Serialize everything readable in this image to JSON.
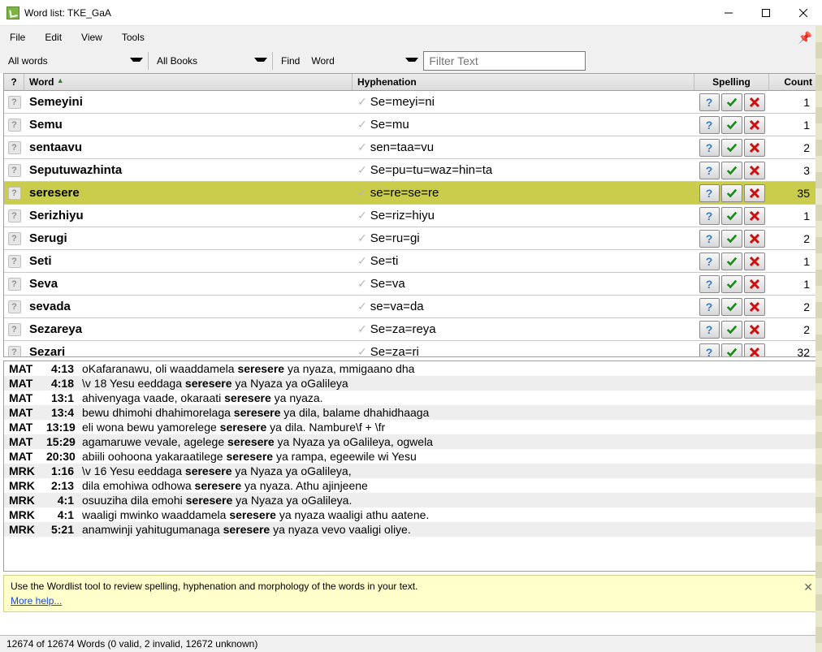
{
  "window": {
    "title": "Word list: TKE_GaA"
  },
  "menu": {
    "file": "File",
    "edit": "Edit",
    "view": "View",
    "tools": "Tools"
  },
  "toolbar": {
    "scope": "All words",
    "books": "All Books",
    "find_label": "Find",
    "find_field": "Word",
    "filter_placeholder": "Filter Text"
  },
  "columns": {
    "q": "?",
    "word": "Word",
    "hyph": "Hyphenation",
    "spell": "Spelling",
    "count": "Count"
  },
  "rows": [
    {
      "word": "Semeyini",
      "hyph": "Se=meyi=ni",
      "count": 1,
      "sel": false
    },
    {
      "word": "Semu",
      "hyph": "Se=mu",
      "count": 1,
      "sel": false
    },
    {
      "word": "sentaavu",
      "hyph": "sen=taa=vu",
      "count": 2,
      "sel": false
    },
    {
      "word": "Seputuwazhinta",
      "hyph": "Se=pu=tu=waz=hin=ta",
      "count": 3,
      "sel": false
    },
    {
      "word": "seresere",
      "hyph": "se=re=se=re",
      "count": 35,
      "sel": true
    },
    {
      "word": "Serizhiyu",
      "hyph": "Se=riz=hiyu",
      "count": 1,
      "sel": false
    },
    {
      "word": "Serugi",
      "hyph": "Se=ru=gi",
      "count": 2,
      "sel": false
    },
    {
      "word": "Seti",
      "hyph": "Se=ti",
      "count": 1,
      "sel": false
    },
    {
      "word": "Seva",
      "hyph": "Se=va",
      "count": 1,
      "sel": false
    },
    {
      "word": "sevada",
      "hyph": "se=va=da",
      "count": 2,
      "sel": false
    },
    {
      "word": "Sezareya",
      "hyph": "Se=za=reya",
      "count": 2,
      "sel": false
    },
    {
      "word": "Sezari",
      "hyph": "Se=za=ri",
      "count": 32,
      "sel": false
    }
  ],
  "concordance": [
    {
      "book": "MAT",
      "cv": "4:13",
      "pre": "oKafaranawu, oli waaddamela ",
      "hit": "seresere",
      "post": " ya nyaza, mmigaano dha"
    },
    {
      "book": "MAT",
      "cv": "4:18",
      "pre": "\\v 18 Yesu eeddaga ",
      "hit": "seresere",
      "post": " ya Nyaza ya oGalileya"
    },
    {
      "book": "MAT",
      "cv": "13:1",
      "pre": "ahivenyaga vaade, okaraati ",
      "hit": "seresere",
      "post": " ya nyaza."
    },
    {
      "book": "MAT",
      "cv": "13:4",
      "pre": "bewu dhimohi dhahimorelaga ",
      "hit": "seresere",
      "post": " ya dila, balame dhahidhaaga"
    },
    {
      "book": "MAT",
      "cv": "13:19",
      "pre": "eli wona bewu yamorelege ",
      "hit": "seresere",
      "post": " ya dila. Nambure\\f + \\fr"
    },
    {
      "book": "MAT",
      "cv": "15:29",
      "pre": "agamaruwe vevale, agelege ",
      "hit": "seresere",
      "post": " ya Nyaza ya oGalileya, ogwela"
    },
    {
      "book": "MAT",
      "cv": "20:30",
      "pre": "abiili oohoona yakaraatilege ",
      "hit": "seresere",
      "post": " ya rampa, egeewile wi Yesu"
    },
    {
      "book": "MRK",
      "cv": "1:16",
      "pre": "\\v 16 Yesu eeddaga ",
      "hit": "seresere",
      "post": " ya Nyaza ya oGalileya,"
    },
    {
      "book": "MRK",
      "cv": "2:13",
      "pre": "dila emohiwa odhowa ",
      "hit": "seresere",
      "post": " ya nyaza. Athu ajinjeene"
    },
    {
      "book": "MRK",
      "cv": "4:1",
      "pre": "osuuziha dila emohi ",
      "hit": "seresere",
      "post": " ya Nyaza ya oGalileya."
    },
    {
      "book": "MRK",
      "cv": "4:1",
      "pre": "waaligi mwinko waaddamela ",
      "hit": "seresere",
      "post": " ya nyaza waaligi athu aatene."
    },
    {
      "book": "MRK",
      "cv": "5:21",
      "pre": "anamwinji yahitugumanaga ",
      "hit": "seresere",
      "post": " ya nyaza vevo vaaligi oliye."
    }
  ],
  "tip": {
    "text": "Use the Wordlist tool to review spelling, hyphenation and morphology of the words in your text.",
    "link": "More help..."
  },
  "status": "12674 of 12674 Words (0 valid, 2 invalid, 12672 unknown)"
}
